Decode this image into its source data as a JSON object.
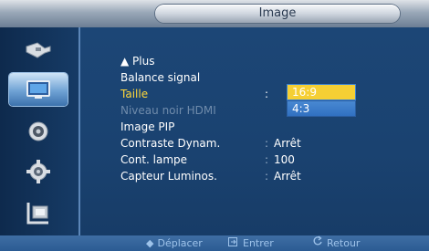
{
  "header": {
    "title": "Image"
  },
  "sidebar": {
    "items": [
      {
        "icon": "input-icon",
        "active": false
      },
      {
        "icon": "picture-icon",
        "active": true
      },
      {
        "icon": "sound-icon",
        "active": false
      },
      {
        "icon": "setup-icon",
        "active": false
      },
      {
        "icon": "multi-window-icon",
        "active": false
      }
    ]
  },
  "menu": {
    "up_label": "▲ Plus",
    "items": [
      {
        "label": "Balance signal",
        "value": ""
      },
      {
        "label": "Taille",
        "value": ""
      },
      {
        "label": "Niveau noir HDMI",
        "value": ""
      },
      {
        "label": "Image PIP",
        "value": ""
      },
      {
        "label": "Contraste Dynam.",
        "value": "Arrêt"
      },
      {
        "label": "Cont. lampe",
        "value": "100"
      },
      {
        "label": "Capteur Luminos.",
        "value": "Arrêt"
      }
    ],
    "colon": ":"
  },
  "dropdown": {
    "options": [
      "16:9",
      "4:3"
    ],
    "highlighted": "16:9"
  },
  "footer": {
    "move": "Déplacer",
    "enter": "Entrer",
    "return": "Retour"
  },
  "colors": {
    "highlight": "#f5cf34",
    "selected_text": "#ffd83a",
    "panel": "#1c4676"
  }
}
